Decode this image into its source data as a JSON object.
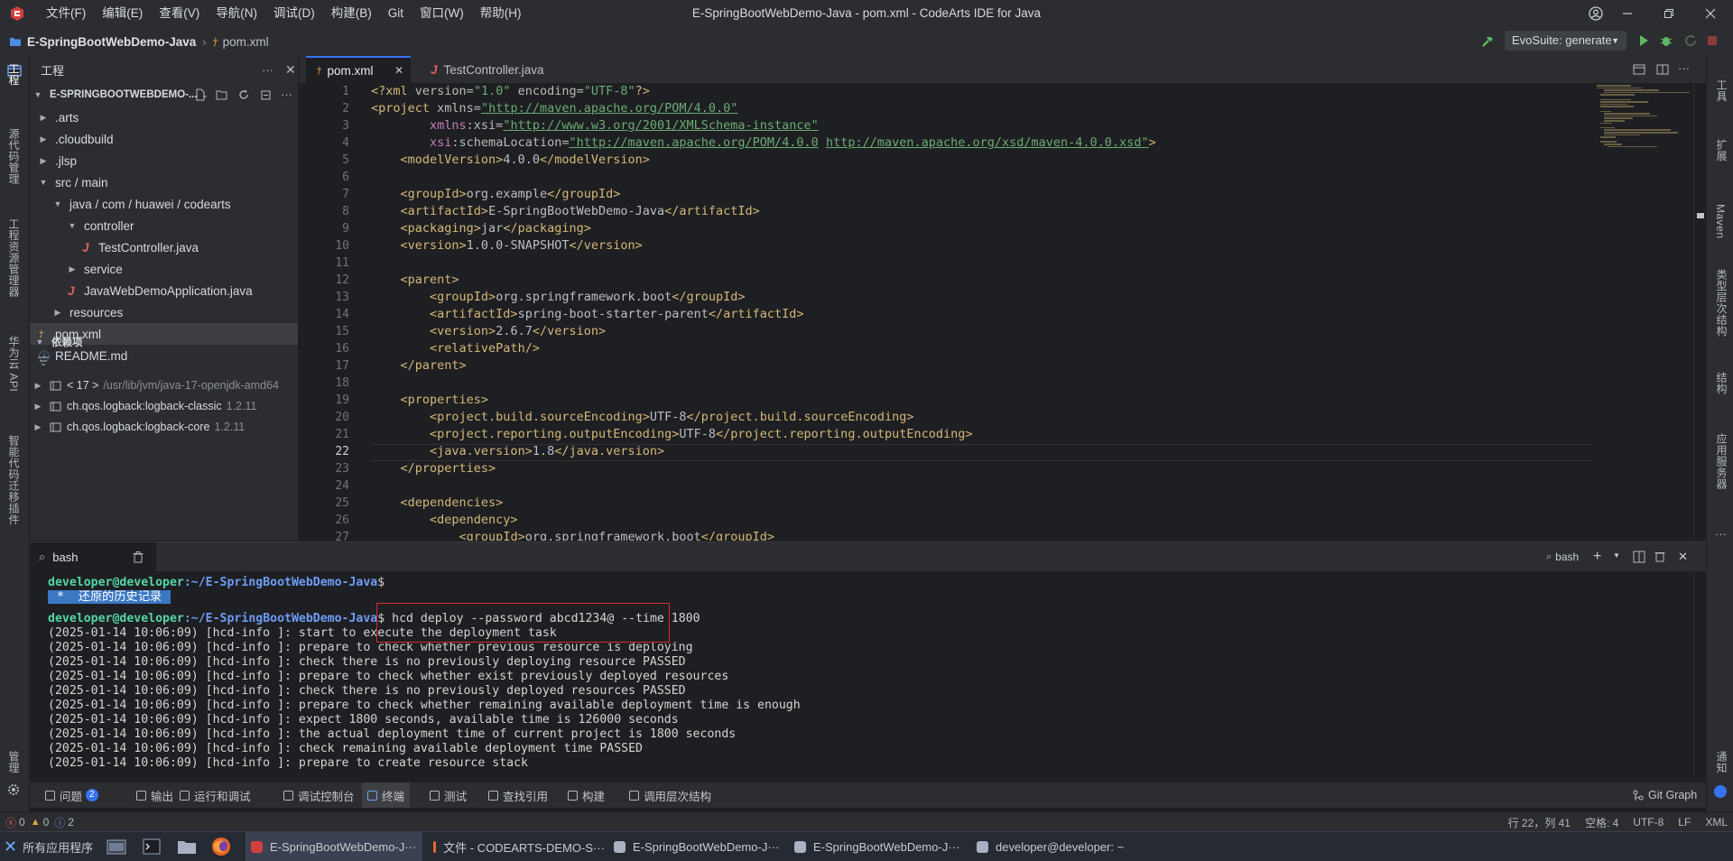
{
  "window": {
    "title": "E-SpringBootWebDemo-Java - pom.xml - CodeArts IDE for Java",
    "menu": [
      "文件(F)",
      "编辑(E)",
      "查看(V)",
      "导航(N)",
      "调试(D)",
      "构建(B)",
      "Git",
      "窗口(W)",
      "帮助(H)"
    ]
  },
  "breadcrumb": {
    "project": "E-SpringBootWebDemo-Java",
    "file": "pom.xml"
  },
  "run_config": {
    "selected": "EvoSuite: generate"
  },
  "left_activity": [
    "工程",
    "源代码管理",
    "工程资源管理器",
    "华为云 API",
    "智能代码迁移插件",
    "管理"
  ],
  "right_activity": [
    "工具",
    "扩展",
    "Maven",
    "类型层次结构",
    "结构",
    "应用服务器",
    "通知"
  ],
  "sidebar": {
    "title": "工程",
    "project_root": "E-SPRINGBOOTWEBDEMO-...",
    "tree": [
      {
        "label": ".arts",
        "indent": 0,
        "icon": "chevron-right",
        "type": "folder"
      },
      {
        "label": ".cloudbuild",
        "indent": 0,
        "icon": "chevron-right",
        "type": "folder"
      },
      {
        "label": ".jlsp",
        "indent": 0,
        "icon": "chevron-right",
        "type": "folder"
      },
      {
        "label": "src / main",
        "indent": 0,
        "icon": "chevron-down",
        "type": "folder"
      },
      {
        "label": "java / com / huawei / codearts",
        "indent": 1,
        "icon": "chevron-down",
        "type": "folder"
      },
      {
        "label": "controller",
        "indent": 2,
        "icon": "chevron-down",
        "type": "folder"
      },
      {
        "label": "TestController.java",
        "indent": 3,
        "icon": "java",
        "type": "file"
      },
      {
        "label": "service",
        "indent": 2,
        "icon": "chevron-right",
        "type": "folder"
      },
      {
        "label": "JavaWebDemoApplication.java",
        "indent": 2,
        "icon": "java",
        "type": "file"
      },
      {
        "label": "resources",
        "indent": 1,
        "icon": "chevron-right",
        "type": "folder"
      },
      {
        "label": "pom.xml",
        "indent": 0,
        "icon": "rss",
        "type": "file",
        "selected": true
      },
      {
        "label": "README.md",
        "indent": 0,
        "icon": "info",
        "type": "file"
      }
    ],
    "deps_title": "依赖项",
    "deps": [
      {
        "name": "< 17 >",
        "detail": "/usr/lib/jvm/java-17-openjdk-amd64"
      },
      {
        "name": "ch.qos.logback:logback-classic",
        "detail": "1.2.11"
      },
      {
        "name": "ch.qos.logback:logback-core",
        "detail": "1.2.11"
      }
    ]
  },
  "editor": {
    "tabs": [
      {
        "label": "pom.xml",
        "active": true
      },
      {
        "label": "TestController.java",
        "active": false
      }
    ],
    "current_line": 22,
    "lines": [
      {
        "n": "1",
        "parts": [
          [
            "t",
            "<?xml "
          ],
          [
            "a",
            "version="
          ],
          [
            "s",
            "\"1.0\""
          ],
          [
            "a",
            " encoding="
          ],
          [
            "s",
            "\"UTF-8\""
          ],
          [
            "t",
            "?>"
          ]
        ]
      },
      {
        "n": "2",
        "parts": [
          [
            "t",
            "<project "
          ],
          [
            "a",
            "xmlns="
          ],
          [
            "u",
            "\"http://maven.apache.org/POM/4.0.0\""
          ]
        ]
      },
      {
        "n": "3",
        "parts": [
          [
            "txt",
            "        "
          ],
          [
            "ns",
            "xmlns"
          ],
          [
            "a",
            ":xsi="
          ],
          [
            "u",
            "\"http://www.w3.org/2001/XMLSchema-instance\""
          ]
        ]
      },
      {
        "n": "4",
        "parts": [
          [
            "txt",
            "        "
          ],
          [
            "ns",
            "xsi"
          ],
          [
            "a",
            ":schemaLocation="
          ],
          [
            "u",
            "\"http://maven.apache.org/POM/4.0.0"
          ],
          [
            "s",
            " "
          ],
          [
            "u",
            "http://maven.apache.org/xsd/maven-4.0.0.xsd\""
          ],
          [
            "t",
            ">"
          ]
        ]
      },
      {
        "n": "5",
        "parts": [
          [
            "txt",
            "    "
          ],
          [
            "t",
            "<modelVersion>"
          ],
          [
            "txt",
            "4.0.0"
          ],
          [
            "t",
            "</modelVersion>"
          ]
        ]
      },
      {
        "n": "6",
        "parts": []
      },
      {
        "n": "7",
        "parts": [
          [
            "txt",
            "    "
          ],
          [
            "t",
            "<groupId>"
          ],
          [
            "txt",
            "org.example"
          ],
          [
            "t",
            "</groupId>"
          ]
        ]
      },
      {
        "n": "8",
        "parts": [
          [
            "txt",
            "    "
          ],
          [
            "t",
            "<artifactId>"
          ],
          [
            "txt",
            "E-SpringBootWebDemo-Java"
          ],
          [
            "t",
            "</artifactId>"
          ]
        ]
      },
      {
        "n": "9",
        "parts": [
          [
            "txt",
            "    "
          ],
          [
            "t",
            "<packaging>"
          ],
          [
            "txt",
            "jar"
          ],
          [
            "t",
            "</packaging>"
          ]
        ]
      },
      {
        "n": "10",
        "parts": [
          [
            "txt",
            "    "
          ],
          [
            "t",
            "<version>"
          ],
          [
            "txt",
            "1.0.0-SNAPSHOT"
          ],
          [
            "t",
            "</version>"
          ]
        ]
      },
      {
        "n": "11",
        "parts": []
      },
      {
        "n": "12",
        "parts": [
          [
            "txt",
            "    "
          ],
          [
            "t",
            "<parent>"
          ]
        ]
      },
      {
        "n": "13",
        "parts": [
          [
            "txt",
            "        "
          ],
          [
            "t",
            "<groupId>"
          ],
          [
            "txt",
            "org.springframework.boot"
          ],
          [
            "t",
            "</groupId>"
          ]
        ]
      },
      {
        "n": "14",
        "parts": [
          [
            "txt",
            "        "
          ],
          [
            "t",
            "<artifactId>"
          ],
          [
            "txt",
            "spring-boot-starter-parent"
          ],
          [
            "t",
            "</artifactId>"
          ]
        ]
      },
      {
        "n": "15",
        "parts": [
          [
            "txt",
            "        "
          ],
          [
            "t",
            "<version>"
          ],
          [
            "txt",
            "2.6.7"
          ],
          [
            "t",
            "</version>"
          ]
        ]
      },
      {
        "n": "16",
        "parts": [
          [
            "txt",
            "        "
          ],
          [
            "t",
            "<relativePath/>"
          ]
        ]
      },
      {
        "n": "17",
        "parts": [
          [
            "txt",
            "    "
          ],
          [
            "t",
            "</parent>"
          ]
        ]
      },
      {
        "n": "18",
        "parts": []
      },
      {
        "n": "19",
        "parts": [
          [
            "txt",
            "    "
          ],
          [
            "t",
            "<properties>"
          ]
        ]
      },
      {
        "n": "20",
        "parts": [
          [
            "txt",
            "        "
          ],
          [
            "t",
            "<project.build.sourceEncoding>"
          ],
          [
            "txt",
            "UTF-8"
          ],
          [
            "t",
            "</project.build.sourceEncoding>"
          ]
        ]
      },
      {
        "n": "21",
        "parts": [
          [
            "txt",
            "        "
          ],
          [
            "t",
            "<project.reporting.outputEncoding>"
          ],
          [
            "txt",
            "UTF-8"
          ],
          [
            "t",
            "</project.reporting.outputEncoding>"
          ]
        ]
      },
      {
        "n": "22",
        "parts": [
          [
            "txt",
            "        "
          ],
          [
            "t",
            "<java.version>"
          ],
          [
            "txt",
            "1.8"
          ],
          [
            "t",
            "</java.version>"
          ]
        ]
      },
      {
        "n": "23",
        "parts": [
          [
            "txt",
            "    "
          ],
          [
            "t",
            "</properties>"
          ]
        ]
      },
      {
        "n": "24",
        "parts": []
      },
      {
        "n": "25",
        "parts": [
          [
            "txt",
            "    "
          ],
          [
            "t",
            "<dependencies>"
          ]
        ]
      },
      {
        "n": "26",
        "parts": [
          [
            "txt",
            "        "
          ],
          [
            "t",
            "<dependency>"
          ]
        ]
      },
      {
        "n": "27",
        "parts": [
          [
            "txt",
            "            "
          ],
          [
            "t",
            "<groupId>"
          ],
          [
            "txt",
            "org.springframework.boot"
          ],
          [
            "t",
            "</groupId>"
          ]
        ]
      }
    ]
  },
  "terminal": {
    "tab_label": "bash",
    "shell_label": "bash",
    "prompt_user": "developer@developer",
    "prompt_path": ":~/E-SpringBootWebDemo-Java",
    "prompt_sign": "$",
    "restored_history": " *  还原的历史记录 ",
    "command": " hcd deploy --password abcd1234@ --time 1800",
    "output": [
      "(2025-01-14 10:06:09) [hcd-info ]: start to execute the deployment task",
      "(2025-01-14 10:06:09) [hcd-info ]: prepare to check whether previous resource is deploying",
      "(2025-01-14 10:06:09) [hcd-info ]: check there is no previously deploying resource PASSED",
      "(2025-01-14 10:06:09) [hcd-info ]: prepare to check whether exist previously deployed resources",
      "(2025-01-14 10:06:09) [hcd-info ]: check there is no previously deployed resources PASSED",
      "(2025-01-14 10:06:09) [hcd-info ]: prepare to check whether remaining available deployment time is enough",
      "(2025-01-14 10:06:09) [hcd-info ]: expect 1800 seconds, available time is 126000 seconds",
      "(2025-01-14 10:06:09) [hcd-info ]: the actual deployment time of current project is 1800 seconds",
      "(2025-01-14 10:06:09) [hcd-info ]: check remaining available deployment time PASSED",
      "(2025-01-14 10:06:09) [hcd-info ]: prepare to create resource stack"
    ]
  },
  "bottom_tools": [
    {
      "label": "问题",
      "icon": "problems-icon",
      "badge": "2"
    },
    {
      "label": "输出",
      "icon": "output-icon"
    },
    {
      "label": "运行和调试",
      "icon": "run-debug-icon"
    },
    {
      "label": "调试控制台",
      "icon": "debug-console-icon"
    },
    {
      "label": "终端",
      "icon": "terminal-icon",
      "active": true
    },
    {
      "label": "测试",
      "icon": "test-icon"
    },
    {
      "label": "查找引用",
      "icon": "find-references-icon"
    },
    {
      "label": "构建",
      "icon": "build-icon"
    },
    {
      "label": "调用层次结构",
      "icon": "call-hierarchy-icon"
    }
  ],
  "git_graph": "Git Graph",
  "status": {
    "errors": "0",
    "warnings": "0",
    "infos": "2",
    "position": "行 22，列 41",
    "indent": "空格: 4",
    "encoding": "UTF-8",
    "eol": "LF",
    "language": "XML"
  },
  "taskbar": {
    "start": "所有应用程序",
    "tasks": [
      {
        "label": "E-SpringBootWebDemo-J···",
        "active": true
      },
      {
        "label": "文件 - CODEARTS-DEMO-S···"
      },
      {
        "label": "E-SpringBootWebDemo-J···"
      },
      {
        "label": "E-SpringBootWebDemo-J···"
      },
      {
        "label": "developer@developer: ~"
      }
    ]
  },
  "colors": {
    "accent": "#3574f0",
    "annotation_box": "#d12c2c"
  }
}
